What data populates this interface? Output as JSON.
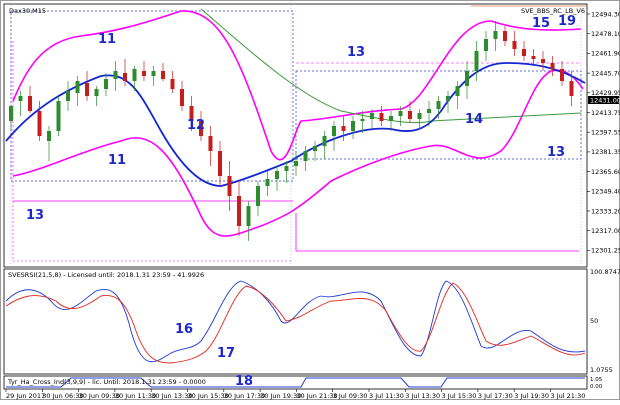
{
  "main_panel": {
    "symbol": "Dax30,M15",
    "indicator_name": "SVE_BBS_RC_LB_V6",
    "price_ticks": [
      "12494.30",
      "12478.10",
      "12461.90",
      "12445.70",
      "12429.95",
      "12413.75",
      "12397.55",
      "12381.35",
      "12365.60",
      "12349.40",
      "12333.20",
      "12317.00",
      "12301.25"
    ],
    "current_price": "12431.00"
  },
  "rsi_panel": {
    "header": "SVESRSI(21,5,8) - Licensed until: 2018.1.31 23:59 - 41.9926",
    "ticks": [
      "100.8747",
      "50",
      "1.0755"
    ]
  },
  "ha_panel": {
    "header": "Tyr_Ha_Cross_Ind(3,9,9) - lic. Until: 2018.1.31 23:59 - 0.0000",
    "ticks": [
      "1.05",
      "0.00"
    ]
  },
  "time_axis": [
    "29 Jun 2017",
    "30 Jun 06:30",
    "30 Jun 09:30",
    "30 Jun 11:30",
    "30 Jun 13:30",
    "30 Jun 15:30",
    "30 Jun 17:30",
    "30 Jun 19:30",
    "30 Jun 21:30",
    "3 Jul 09:30",
    "3 Jul 11:30",
    "3 Jul 13:30",
    "3 Jul 15:30",
    "3 Jul 17:30",
    "3 Jul 19:30",
    "3 Jul 21:30"
  ],
  "annotations": [
    "11",
    "11",
    "12",
    "13",
    "13",
    "13",
    "14",
    "15",
    "19",
    "16",
    "17",
    "18"
  ],
  "colors": {
    "bull": "#2e8b2e",
    "bear": "#c41e1e",
    "ma_blue": "#1428d2",
    "band_magenta": "#ff00ff",
    "ma_green": "#3c9a3c",
    "annotation_blue": "#1e28c8",
    "rsi_blue": "#1f3bd4",
    "rsi_red": "#e0281e"
  }
}
